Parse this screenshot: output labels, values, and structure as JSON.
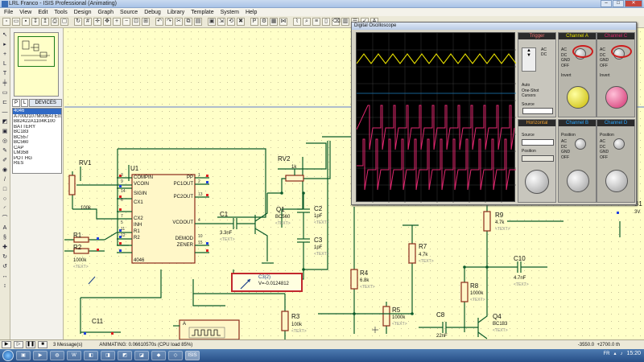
{
  "window": {
    "title": "LRL Franco - ISIS Professional (Animating)"
  },
  "menu": [
    "File",
    "View",
    "Edit",
    "Tools",
    "Design",
    "Graph",
    "Source",
    "Debug",
    "Library",
    "Template",
    "System",
    "Help"
  ],
  "sidepanel": {
    "tabs": [
      "P",
      "L"
    ],
    "devices_header": "DEVICES",
    "devices": [
      "4046",
      "A700D107M006ATE018",
      "B82422A1104K100",
      "BATTERY",
      "BC183",
      "BC557",
      "BC560",
      "CAP",
      "LM358",
      "POT HG",
      "RES"
    ],
    "selected_index": 0
  },
  "oscilloscope": {
    "title": "Digital Oscilloscope",
    "channels": [
      {
        "name": "Channel A",
        "color": "#e8e000"
      },
      {
        "name": "Channel B",
        "color": "#e0286e"
      },
      {
        "name": "Channel C",
        "color": "#e0286e"
      },
      {
        "name": "Channel D",
        "color": "#2aa7ff"
      }
    ],
    "trigger_label": "Trigger",
    "horizontal_label": "Horizontal",
    "source_label": "Source",
    "cursors_label": "Cursors",
    "modes": [
      "Auto",
      "One-Shot",
      "Cursors"
    ],
    "coupling": [
      "AC",
      "DC",
      "GND",
      "OFF"
    ],
    "invert_label": "Invert",
    "position_label": "Position"
  },
  "schematic": {
    "components": {
      "U1": "U1",
      "U1_part": "4046",
      "RV1": "RV1",
      "RV1_val": "100k",
      "RV2": "RV2",
      "RV2_val": "1k",
      "Q1": "Q1",
      "Q1_part": "BC560",
      "C1": "C1",
      "C1_val": "3.3nF",
      "C2": "C2",
      "C2_val": "1pF",
      "C3": "C3",
      "C3_val": "1pF",
      "R1": "R1",
      "R2": "R2",
      "R2_val": "1000k",
      "R3": "R3",
      "R3_val": "100k",
      "R4": "R4",
      "R4_val": "6.8k",
      "R5": "R5",
      "R5_val": "1000k",
      "R7": "R7",
      "R7_val": "4.7k",
      "R8": "R8",
      "R8_val": "1000k",
      "R9": "R9",
      "R9_val": "4.7k",
      "C8": "C8",
      "C8_val": "22nF",
      "C10": "C10",
      "C10_val": "4.7nF",
      "C11": "C11",
      "Q4": "Q4",
      "Q4_part": "BC183",
      "text_placeholder": "<TEXT>",
      "A_label": "A",
      "B1_partial": "B1",
      "V_partial": "3V"
    },
    "u1_pins_left": [
      {
        "num": "3",
        "name": "COMPIN"
      },
      {
        "num": "9",
        "name": "VCOIN"
      },
      {
        "num": "14",
        "name": "SIGIN"
      },
      {
        "num": "6",
        "name": "CX1"
      },
      {
        "num": "7",
        "name": "CX2"
      },
      {
        "num": "5",
        "name": "INH"
      },
      {
        "num": "11",
        "name": "R1"
      },
      {
        "num": "12",
        "name": "R2"
      }
    ],
    "u1_pins_right": [
      {
        "num": "1",
        "name": "PP"
      },
      {
        "num": "2",
        "name": "PC1OUT"
      },
      {
        "num": "13",
        "name": "PC2OUT"
      },
      {
        "num": "4",
        "name": "VCOOUT"
      },
      {
        "num": "10",
        "name": "DEMOD"
      },
      {
        "num": "15",
        "name": "ZENER"
      }
    ],
    "probe": {
      "label": "C3(2)",
      "value": "V=-0.0124812"
    }
  },
  "status": {
    "messages": "3 Message(s)",
    "animating": "ANIMATING: 0.06610570s (CPU load 85%)",
    "coord_x": "-3550.0",
    "coord_y": "+2700.0",
    "unit": "th"
  },
  "taskbar": {
    "lang": "FR",
    "time": "15:20",
    "isis_label": "ISIS"
  }
}
